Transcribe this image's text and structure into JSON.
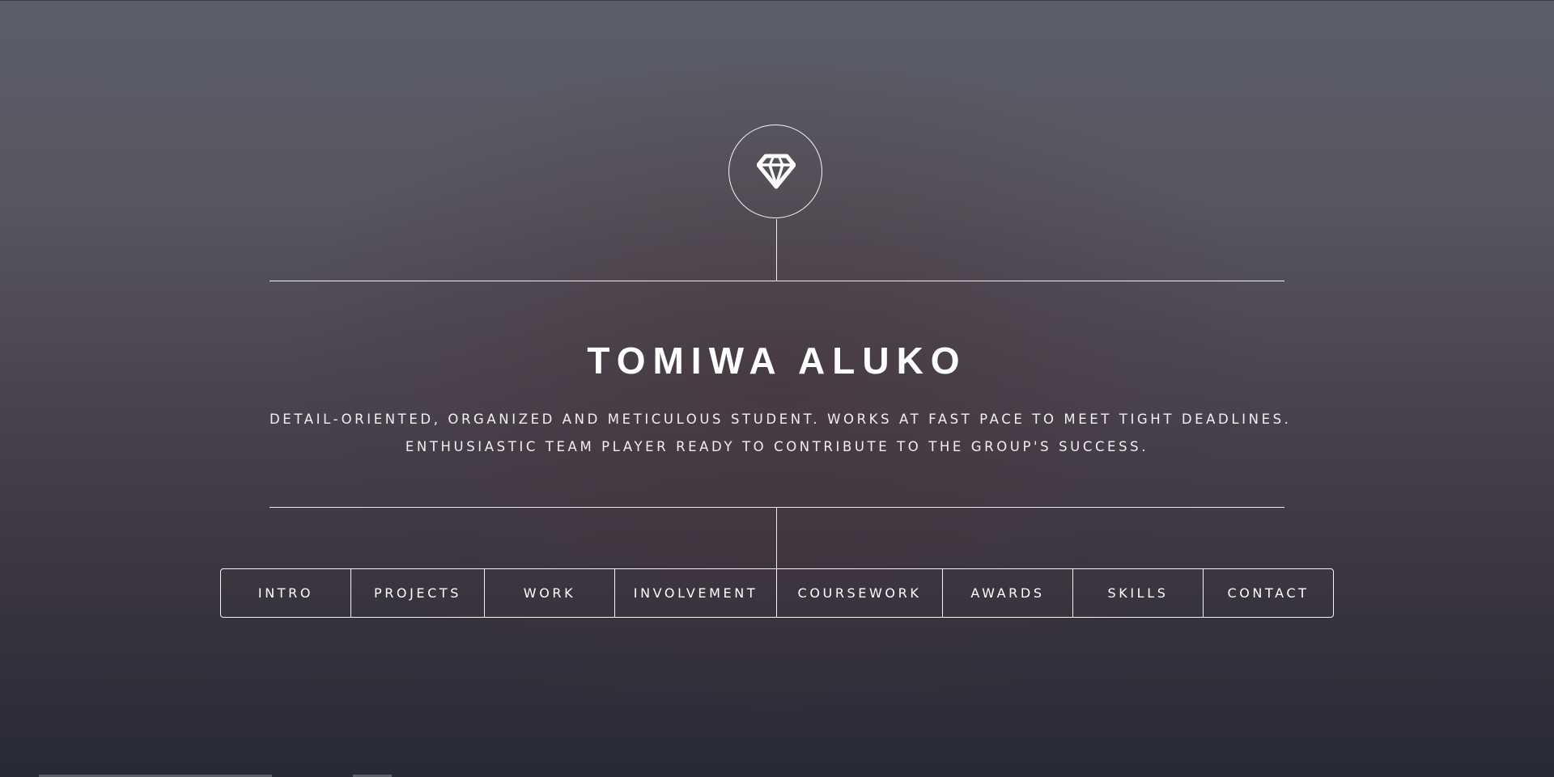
{
  "header": {
    "logo_icon": "diamond-icon"
  },
  "main": {
    "title": "TOMIWA ALUKO",
    "tagline_line1": "DETAIL-ORIENTED, ORGANIZED AND METICULOUS STUDENT. WORKS AT FAST PACE TO MEET TIGHT DEADLINES.",
    "tagline_line2": "ENTHUSIASTIC TEAM PLAYER READY TO CONTRIBUTE TO THE GROUP'S SUCCESS."
  },
  "nav": {
    "items": [
      {
        "label": "INTRO"
      },
      {
        "label": "PROJECTS"
      },
      {
        "label": "WORK"
      },
      {
        "label": "INVOLVEMENT"
      },
      {
        "label": "COURSEWORK"
      },
      {
        "label": "AWARDS"
      },
      {
        "label": "SKILLS"
      },
      {
        "label": "CONTACT"
      }
    ]
  },
  "colors": {
    "foreground": "#ffffff",
    "background_top": "#5b5f6b",
    "background_bottom": "#272a36"
  }
}
